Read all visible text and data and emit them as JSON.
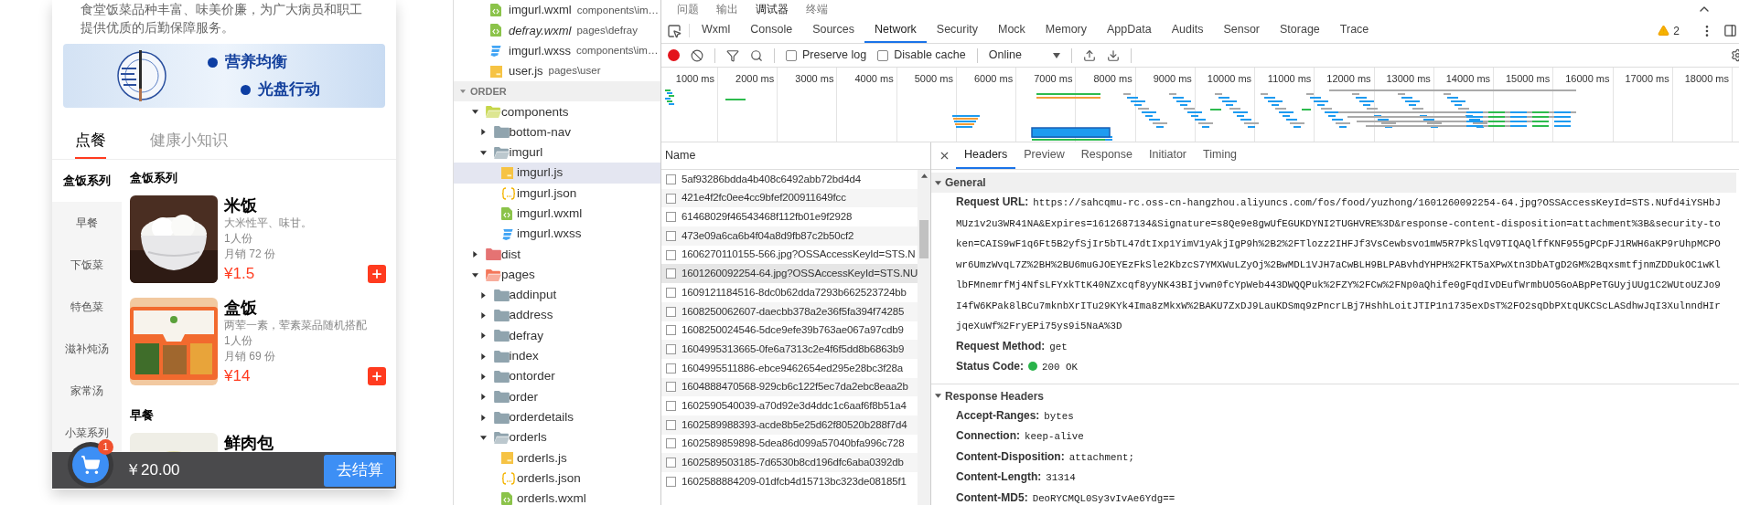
{
  "phone": {
    "intro": "食堂饭菜品种丰富、味美价廉，为广大病员和职工提供优质的后勤保障服务。",
    "banner": {
      "lines": [
        "营养均衡",
        "光盘行动"
      ]
    },
    "tabs": [
      {
        "label": "点餐",
        "selected": true
      },
      {
        "label": "健康小知识",
        "selected": false
      }
    ],
    "categories": [
      {
        "label": "盒饭系列",
        "selected": true
      },
      {
        "label": "早餐",
        "selected": false
      },
      {
        "label": "下饭菜",
        "selected": false
      },
      {
        "label": "特色菜",
        "selected": false
      },
      {
        "label": "滋补炖汤",
        "selected": false
      },
      {
        "label": "家常汤",
        "selected": false
      },
      {
        "label": "小菜系列",
        "selected": false
      }
    ],
    "sections": [
      {
        "title": "盒饭系列",
        "items": [
          {
            "name": "米饭",
            "desc": "大米性平、味甘。",
            "portion": "1人份",
            "sales": "月销 72 份",
            "price": "¥1.5"
          },
          {
            "name": "盒饭",
            "desc": "两荤一素，荤素菜品随机搭配",
            "portion": "1人份",
            "sales": "月销 69 份",
            "price": "¥14"
          }
        ]
      },
      {
        "title": "早餐",
        "items": [
          {
            "name": "鲜肉包"
          }
        ]
      }
    ],
    "cart": {
      "badge": "1",
      "total": "￥20.00",
      "checkout": "去结算"
    }
  },
  "open_editors": [
    {
      "name": "imgurl.wxml",
      "path": "components\\im…",
      "kind": "wxml",
      "preview": false
    },
    {
      "name": "defray.wxml",
      "path": "pages\\defray",
      "kind": "wxml",
      "preview": true
    },
    {
      "name": "imgurl.wxss",
      "path": "components\\im…",
      "kind": "wxss",
      "preview": false
    },
    {
      "name": "user.js",
      "path": "pages\\user",
      "kind": "js",
      "preview": false
    }
  ],
  "explorer": {
    "title": "ORDER",
    "expanded": true,
    "tree": [
      {
        "name": "components",
        "kind": "folder",
        "color": "#c6d64a",
        "expanded": true,
        "selected": false,
        "children": [
          {
            "name": "bottom-nav",
            "kind": "folder",
            "color": "#90a4ae",
            "expanded": false,
            "selected": false
          },
          {
            "name": "imgurl",
            "kind": "folder",
            "color": "#90a4ae",
            "expanded": true,
            "selected": false,
            "children": [
              {
                "name": "imgurl.js",
                "kind": "js",
                "selected": true
              },
              {
                "name": "imgurl.json",
                "kind": "json",
                "selected": false
              },
              {
                "name": "imgurl.wxml",
                "kind": "wxml",
                "selected": false
              },
              {
                "name": "imgurl.wxss",
                "kind": "wxss",
                "selected": false
              }
            ]
          }
        ]
      },
      {
        "name": "dist",
        "kind": "folder",
        "color": "#e57373",
        "expanded": false,
        "selected": false
      },
      {
        "name": "pages",
        "kind": "folder",
        "color": "#f4775a",
        "expanded": true,
        "selected": false,
        "children": [
          {
            "name": "addinput",
            "kind": "folder",
            "color": "#90a4ae",
            "expanded": false,
            "selected": false
          },
          {
            "name": "address",
            "kind": "folder",
            "color": "#90a4ae",
            "expanded": false,
            "selected": false
          },
          {
            "name": "defray",
            "kind": "folder",
            "color": "#90a4ae",
            "expanded": false,
            "selected": false
          },
          {
            "name": "index",
            "kind": "folder",
            "color": "#90a4ae",
            "expanded": false,
            "selected": false
          },
          {
            "name": "ontorder",
            "kind": "folder",
            "color": "#90a4ae",
            "expanded": false,
            "selected": false
          },
          {
            "name": "order",
            "kind": "folder",
            "color": "#90a4ae",
            "expanded": false,
            "selected": false
          },
          {
            "name": "orderdetails",
            "kind": "folder",
            "color": "#90a4ae",
            "expanded": false,
            "selected": false
          },
          {
            "name": "orderls",
            "kind": "folder",
            "color": "#90a4ae",
            "expanded": true,
            "selected": false,
            "children": [
              {
                "name": "orderls.js",
                "kind": "js",
                "selected": false
              },
              {
                "name": "orderls.json",
                "kind": "json",
                "selected": false
              },
              {
                "name": "orderls.wxml",
                "kind": "wxml",
                "selected": false
              }
            ]
          }
        ]
      }
    ]
  },
  "devtools": {
    "drawer_tabs": [
      {
        "label": "问题",
        "selected": false
      },
      {
        "label": "输出",
        "selected": false
      },
      {
        "label": "调试器",
        "selected": true
      },
      {
        "label": "终端",
        "selected": false
      }
    ],
    "panel_tabs": [
      {
        "label": "Wxml",
        "selected": false
      },
      {
        "label": "Console",
        "selected": false
      },
      {
        "label": "Sources",
        "selected": false
      },
      {
        "label": "Network",
        "selected": true
      },
      {
        "label": "Security",
        "selected": false
      },
      {
        "label": "Mock",
        "selected": false
      },
      {
        "label": "Memory",
        "selected": false
      },
      {
        "label": "AppData",
        "selected": false
      },
      {
        "label": "Audits",
        "selected": false
      },
      {
        "label": "Sensor",
        "selected": false
      },
      {
        "label": "Storage",
        "selected": false
      },
      {
        "label": "Trace",
        "selected": false
      }
    ],
    "warnings": "2",
    "toolbar": {
      "recording": true,
      "preserve_log": {
        "label": "Preserve log",
        "checked": false
      },
      "disable_cache": {
        "label": "Disable cache",
        "checked": false
      },
      "throttling": "Online"
    },
    "overview": {
      "ticks": [
        "1000 ms",
        "2000 ms",
        "3000 ms",
        "4000 ms",
        "5000 ms",
        "6000 ms",
        "7000 ms",
        "8000 ms",
        "9000 ms",
        "10000 ms",
        "11000 ms",
        "12000 ms",
        "13000 ms",
        "14000 ms",
        "15000 ms",
        "16000 ms",
        "17000 ms",
        "18000 ms"
      ]
    },
    "requests": {
      "column": "Name",
      "rows": [
        {
          "name": "5af93286bdda4b408c6492abb72bd4d4",
          "selected": false
        },
        {
          "name": "421e4f2fc0ee4cc9bfef200911649fcc",
          "selected": false
        },
        {
          "name": "61468029f46543468f112fb01e9f2928",
          "selected": false
        },
        {
          "name": "473e09a6ca6b4f04a8d9fb87c2b50cf2",
          "selected": false
        },
        {
          "name": "1606270110155-566.jpg?OSSAccessKeyId=STS.N",
          "selected": false
        },
        {
          "name": "1601260092254-64.jpg?OSSAccessKeyId=STS.NU",
          "selected": true
        },
        {
          "name": "1609121184516-8dc0b62dda7293b662523724bb",
          "selected": false
        },
        {
          "name": "1608250062607-daecbb378a2e36f5fa394f74285",
          "selected": false
        },
        {
          "name": "1608250024546-5dce9efe39b763ae067a97cdb9",
          "selected": false
        },
        {
          "name": "1604995313665-0fe6a7313c2e4f6f5dd8b6863b9",
          "selected": false
        },
        {
          "name": "1604995511886-ebce9462654ed295e28bc3f28a",
          "selected": false
        },
        {
          "name": "1604888470568-929cb6c122f5ec7da2ebc8eaa2b",
          "selected": false
        },
        {
          "name": "1602590540039-a70d92e3d4ddc1c6aaf6f8b51a4",
          "selected": false
        },
        {
          "name": "1602589988393-acde8b5e25d62f80520b288f7d4",
          "selected": false
        },
        {
          "name": "1602589859898-5dea86d099a57040bfa996c728",
          "selected": false
        },
        {
          "name": "1602589503185-7d6530b8cd196dfc6aba0392db",
          "selected": false
        },
        {
          "name": "1602588884209-01dfcb4d15713bc323de08185f1",
          "selected": false
        }
      ]
    },
    "details": {
      "tabs": [
        {
          "label": "Headers",
          "selected": true
        },
        {
          "label": "Preview",
          "selected": false
        },
        {
          "label": "Response",
          "selected": false
        },
        {
          "label": "Initiator",
          "selected": false
        },
        {
          "label": "Timing",
          "selected": false
        }
      ],
      "sections": [
        {
          "title": "General",
          "expanded": true,
          "fields": [
            {
              "kind": "text",
              "label": "Request URL:",
              "value": "https://sahcqmu-rc.oss-cn-hangzhou.aliyuncs.com/fos/food/yuzhong/1601260092254-64.jpg?OSSAccessKeyId=STS.NUfd4iYSHbJMUz1v2u3WR41NA&Expires=1612687134&Signature=s8Qe9e8gwUfEGUKDYNI2TUGHVRE%3D&response-content-disposition=attachment%3B&security-token=CAIS9wF1q6Ft5B2yfSjIr5bTL47dtIxp1YimV1yAkjIgP9h%2B2%2FTlozz2IHFJf3VsCewbsvo1mW5R7PkSlqV9TIQAQlffKNF955gPCpFJ1RWH6aKP9rUhpMCPOwr6UmzWvqL7Z%2BH%2BU6muGJOEYEzFkSle2KbzcS7YMXWuLZyOj%2BwMDL1VJH7aCwBLH9BLPABvhdYHPH%2FKT5aXPwXtn3DbATgD2GM%2BqxsmtfjnmZDDukOC1wKllbFMnemrfMj4NfsLFYxkTtK40NZxcqf8yyNK43BIjvwn0fcYpWeb443DWQQPuk%2FZY%2FCw%2FNp0aQhife0gFqdIvDEufWrmbUO5GoABpPeTGUyjUUg1C2WUtoUZJo9I4fW6KPak8lBCu7mknbXrITu29KYk4Ima8zMkxW%2BAKU7ZxDJ9LauKDSmq9zPncrLBj7HshhLoitJTIP1n1735exDsT%2FO2sqDbPXtqUKCScLASdhwJqI3XulnndHIrjqeXuWf%2FryEPi75ys9i5NaA%3D"
            },
            {
              "kind": "text",
              "label": "Request Method:",
              "value": "get"
            },
            {
              "kind": "status",
              "label": "Status Code:",
              "value": "200 OK",
              "color": "#29b34a"
            }
          ]
        },
        {
          "title": "Response Headers",
          "expanded": true,
          "fields": [
            {
              "kind": "text",
              "label": "Accept-Ranges:",
              "value": "bytes"
            },
            {
              "kind": "text",
              "label": "Connection:",
              "value": "keep-alive"
            },
            {
              "kind": "text",
              "label": "Content-Disposition:",
              "value": "attachment;"
            },
            {
              "kind": "text",
              "label": "Content-Length:",
              "value": "31314"
            },
            {
              "kind": "text",
              "label": "Content-MD5:",
              "value": "DeoRYCMQL0Sy3vIvAe6Ydg=="
            }
          ]
        }
      ]
    }
  }
}
